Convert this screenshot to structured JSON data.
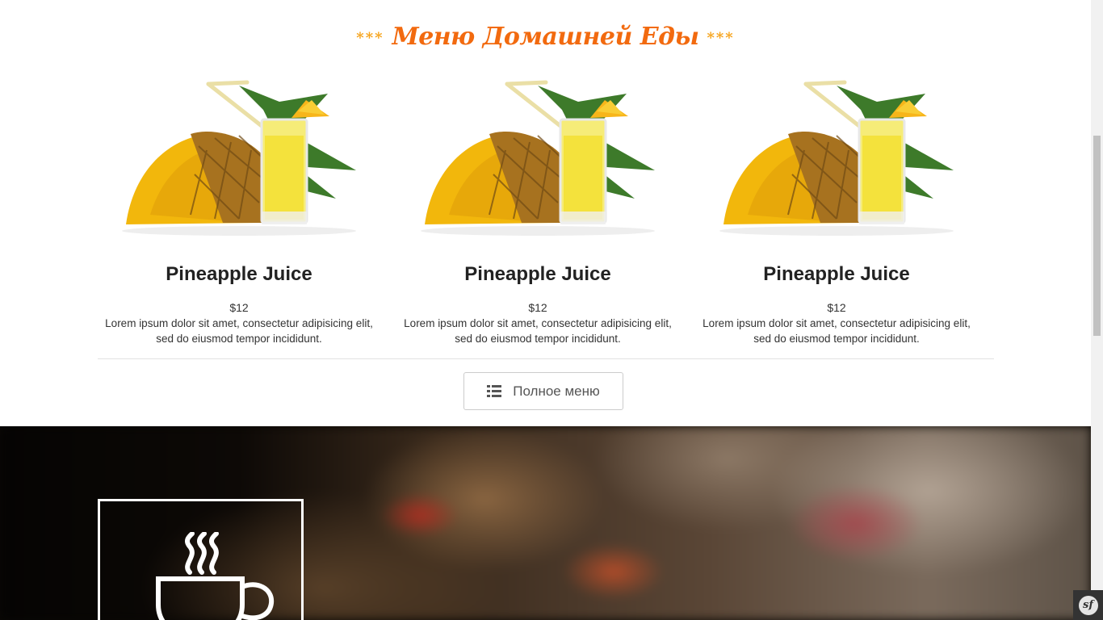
{
  "menu_section": {
    "title": "Меню Домашней Еды",
    "title_stars": "***",
    "accent_color": "#f26a0f",
    "items": [
      {
        "name": "Pineapple Juice",
        "price": "$12",
        "description": "Lorem ipsum dolor sit amet, consectetur adipisicing elit, sed do eiusmod tempor incididunt.",
        "image": "pineapple-juice-image"
      },
      {
        "name": "Pineapple Juice",
        "price": "$12",
        "description": "Lorem ipsum dolor sit amet, consectetur adipisicing elit, sed do eiusmod tempor incididunt.",
        "image": "pineapple-juice-image"
      },
      {
        "name": "Pineapple Juice",
        "price": "$12",
        "description": "Lorem ipsum dolor sit amet, consectetur adipisicing elit, sed do eiusmod tempor incididunt.",
        "image": "pineapple-juice-image"
      }
    ],
    "full_menu_button": {
      "label": "Полное меню",
      "icon": "list-icon"
    }
  },
  "hero_section": {
    "icon": "coffee-cup-icon"
  },
  "debug_badge": {
    "label": "sf",
    "icon": "symfony-icon"
  }
}
